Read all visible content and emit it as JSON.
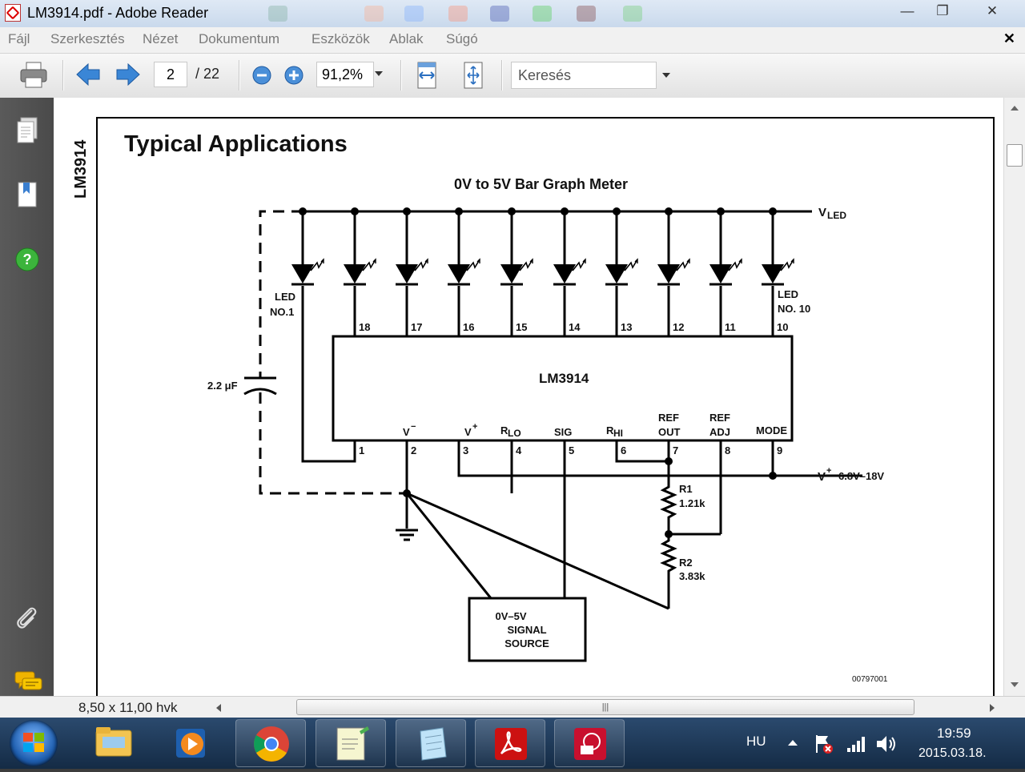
{
  "window": {
    "title": "LM3914.pdf - Adobe Reader",
    "minimize": "—",
    "maximize": "❐",
    "close": "✕"
  },
  "menu": {
    "items": [
      "Fájl",
      "Szerkesztés",
      "Nézet",
      "Dokumentum",
      "Eszközök",
      "Ablak",
      "Súgó"
    ],
    "close": "✕"
  },
  "toolbar": {
    "page_current": "2",
    "page_total": "/ 22",
    "zoom": "91,2%",
    "search_placeholder": "Keresés"
  },
  "document": {
    "side_label": "LM3914",
    "heading": "Typical Applications",
    "figure_title": "0V to 5V Bar Graph Meter",
    "figure_id": "00797001",
    "circuit": {
      "supply_led": "V",
      "supply_led_sub": "LED",
      "chip": "LM3914",
      "led_first": [
        "LED",
        "NO.1"
      ],
      "led_last": [
        "LED",
        "NO. 10"
      ],
      "capacitor": "2.2 μF",
      "pins_top": [
        "18",
        "17",
        "16",
        "15",
        "14",
        "13",
        "12",
        "11",
        "10"
      ],
      "pins_bottom": [
        "1",
        "2",
        "3",
        "4",
        "5",
        "6",
        "7",
        "8",
        "9"
      ],
      "pin_labels": {
        "vminus": "V",
        "vplus": "V",
        "rlo": "R",
        "rlo_sub": "LO",
        "sig": "SIG",
        "rhi": "R",
        "rhi_sub": "HI",
        "refout": [
          "REF",
          "OUT"
        ],
        "refadj": [
          "REF",
          "ADJ"
        ],
        "mode": "MODE"
      },
      "supply_main": "V",
      "supply_main_range": "6.8V–18V",
      "r1": [
        "R1",
        "1.21k"
      ],
      "r2": [
        "R2",
        "3.83k"
      ],
      "source": [
        "0V–5V",
        "SIGNAL",
        "SOURCE"
      ]
    }
  },
  "status": {
    "page_size": "8,50 x 11,00 hvk"
  },
  "taskbar": {
    "language": "HU",
    "time": "19:59",
    "date": "2015.03.18."
  },
  "colors": {
    "accent_blue": "#3a86d6",
    "help_green": "#3cb43c",
    "pdf_red": "#cc1111"
  }
}
